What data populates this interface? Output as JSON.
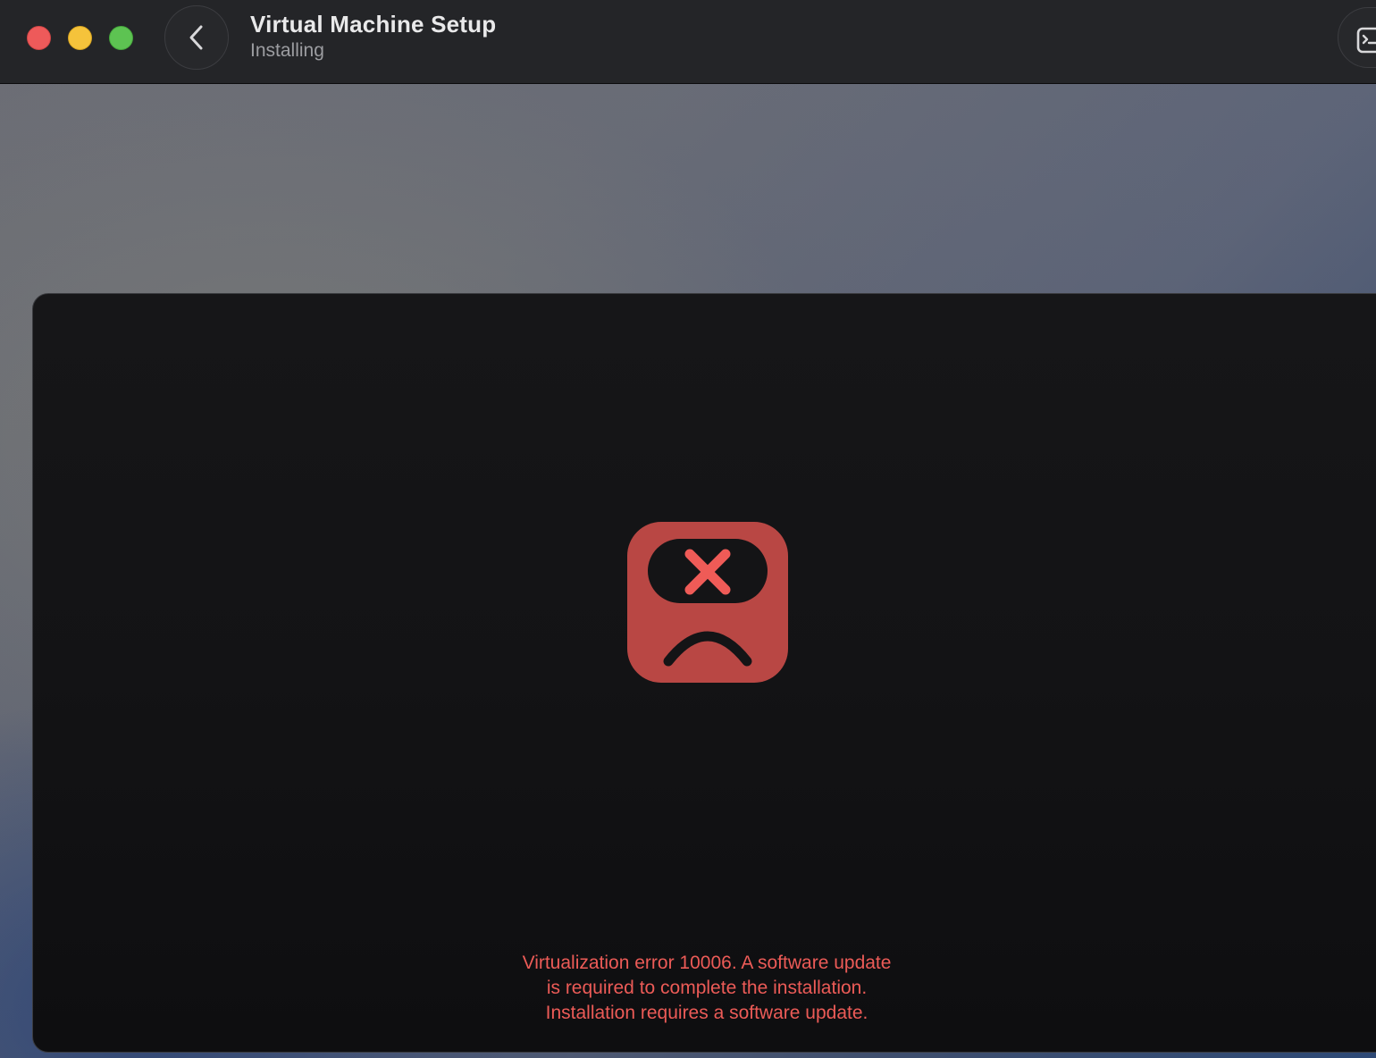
{
  "window": {
    "title": "Virtual Machine Setup",
    "subtitle": "Installing"
  },
  "titlebar": {
    "icons": {
      "back": "chevron-left-icon",
      "console": "terminal-icon"
    }
  },
  "colors": {
    "close": "#ee5a5a",
    "minimize": "#f5c33b",
    "zoom": "#5dc352",
    "error_icon_bg": "#b94744",
    "error_x": "#ef5b57",
    "error_text": "#ec5b57"
  },
  "error": {
    "icon": "vm-error-sad-face-icon",
    "lines": [
      "Virtualization error 10006. A software update",
      "is required to complete the installation.",
      "Installation requires a software update."
    ]
  }
}
